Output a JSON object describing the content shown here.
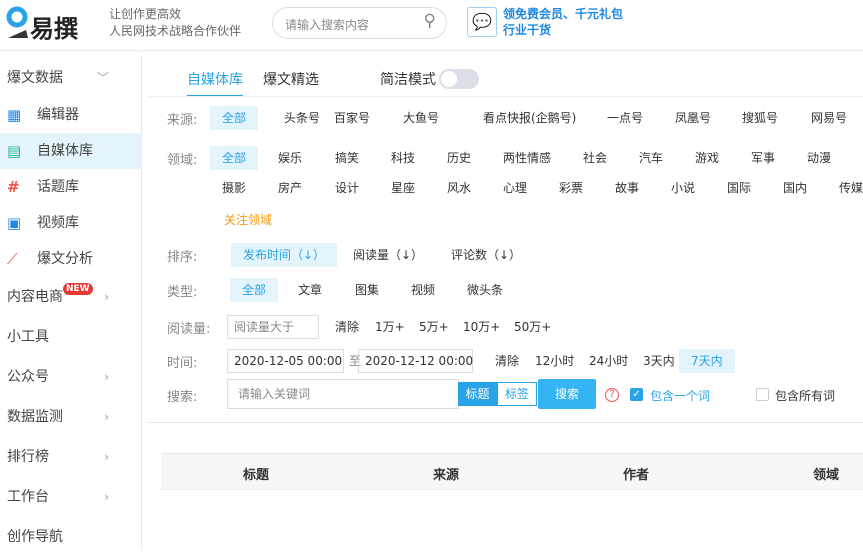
{
  "header": {
    "logo": "易撰",
    "slogan1": "让创作更高效",
    "slogan2": "人民网技术战略合作伙伴",
    "search_placeholder": "请输入搜索内容",
    "promo1": "领免费会员、千元礼包",
    "promo2": "行业干货"
  },
  "sidebar": {
    "items": [
      {
        "label": "爆文数据",
        "icon": "chevron-down"
      },
      {
        "label": "编辑器",
        "icon": "grid-icon"
      },
      {
        "label": "自媒体库",
        "icon": "document-icon",
        "active": true
      },
      {
        "label": "话题库",
        "icon": "hash-icon"
      },
      {
        "label": "视频库",
        "icon": "video-icon"
      },
      {
        "label": "爆文分析",
        "icon": "chart-icon"
      },
      {
        "label": "内容电商",
        "badge": "NEW"
      },
      {
        "label": "小工具"
      },
      {
        "label": "公众号"
      },
      {
        "label": "数据监测"
      },
      {
        "label": "排行榜"
      },
      {
        "label": "工作台"
      },
      {
        "label": "创作导航"
      }
    ]
  },
  "tabs": [
    {
      "label": "自媒体库",
      "active": true
    },
    {
      "label": "爆文精选"
    }
  ],
  "simple_mode": {
    "label": "简洁模式",
    "on": false
  },
  "filters": {
    "source": {
      "label": "来源:",
      "options": [
        "全部",
        "头条号",
        "百家号",
        "大鱼号",
        "看点快报(企鹅号)",
        "一点号",
        "凤凰号",
        "搜狐号",
        "网易号"
      ]
    },
    "domain": {
      "label": "领域:",
      "row1": [
        "全部",
        "娱乐",
        "搞笑",
        "科技",
        "历史",
        "两性情感",
        "社会",
        "汽车",
        "游戏",
        "军事",
        "动漫"
      ],
      "row2": [
        "摄影",
        "房产",
        "设计",
        "星座",
        "风水",
        "心理",
        "彩票",
        "故事",
        "小说",
        "国际",
        "国内",
        "传媒"
      ],
      "follow": "关注领域"
    },
    "sort": {
      "label": "排序:",
      "options": [
        "发布时间（↓）",
        "阅读量（↓）",
        "评论数（↓）"
      ]
    },
    "type": {
      "label": "类型:",
      "options": [
        "全部",
        "文章",
        "图集",
        "视频",
        "微头条"
      ]
    },
    "reads": {
      "label": "阅读量:",
      "placeholder": "阅读量大于",
      "options": [
        "清除",
        "1万+",
        "5万+",
        "10万+",
        "50万+"
      ]
    },
    "time": {
      "label": "时间:",
      "from": "2020-12-05 00:00",
      "to_label": "至",
      "to": "2020-12-12 00:00",
      "options": [
        "清除",
        "12小时",
        "24小时",
        "3天内",
        "7天内"
      ]
    },
    "search": {
      "label": "搜索:",
      "placeholder": "请输入关键词",
      "mode1": "标题",
      "mode2": "标签",
      "button": "搜索",
      "help": "?",
      "check1": "包含一个词",
      "check2": "包含所有词"
    }
  },
  "table": {
    "headers": [
      "标题",
      "来源",
      "作者",
      "领域"
    ]
  },
  "colors": {
    "accent": "#29a3e8",
    "active_bg": "#e3f4fc"
  }
}
